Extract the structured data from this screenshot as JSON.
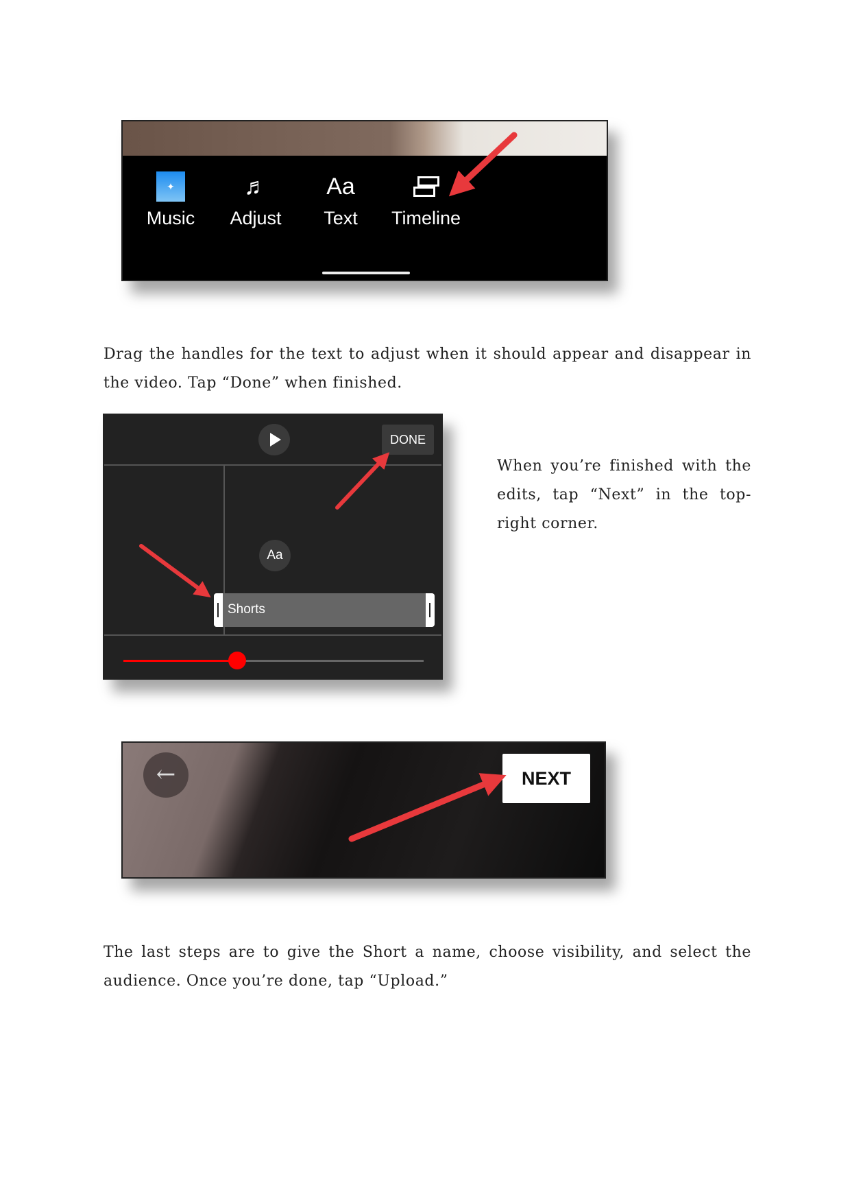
{
  "toolbar": {
    "items": [
      {
        "label": "Music",
        "icon": "music-thumbnail-icon"
      },
      {
        "label": "Adjust",
        "icon": "music-note-scissors-icon"
      },
      {
        "label": "Text",
        "icon": "text-aa-icon",
        "glyph": "Aa"
      },
      {
        "label": "Timeline",
        "icon": "timeline-icon"
      }
    ]
  },
  "paragraph1": "Drag the handles for the text to adjust when it should appear and disappear in the video. Tap “Done” when finished.",
  "editor": {
    "done_label": "DONE",
    "text_icon": "Aa",
    "clip_label": "Shorts",
    "playback_progress": 0.38
  },
  "paragraph2": "When you’re finished with the edits, tap “Next” in the top-right corner.",
  "next_screen": {
    "next_label": "NEXT"
  },
  "paragraph3": "The last steps are to give the Short a name, choose visibility, and select the audience. Once you’re done, tap “Upload.”",
  "colors": {
    "arrow": "#e8393c",
    "slider": "#ff0000"
  }
}
